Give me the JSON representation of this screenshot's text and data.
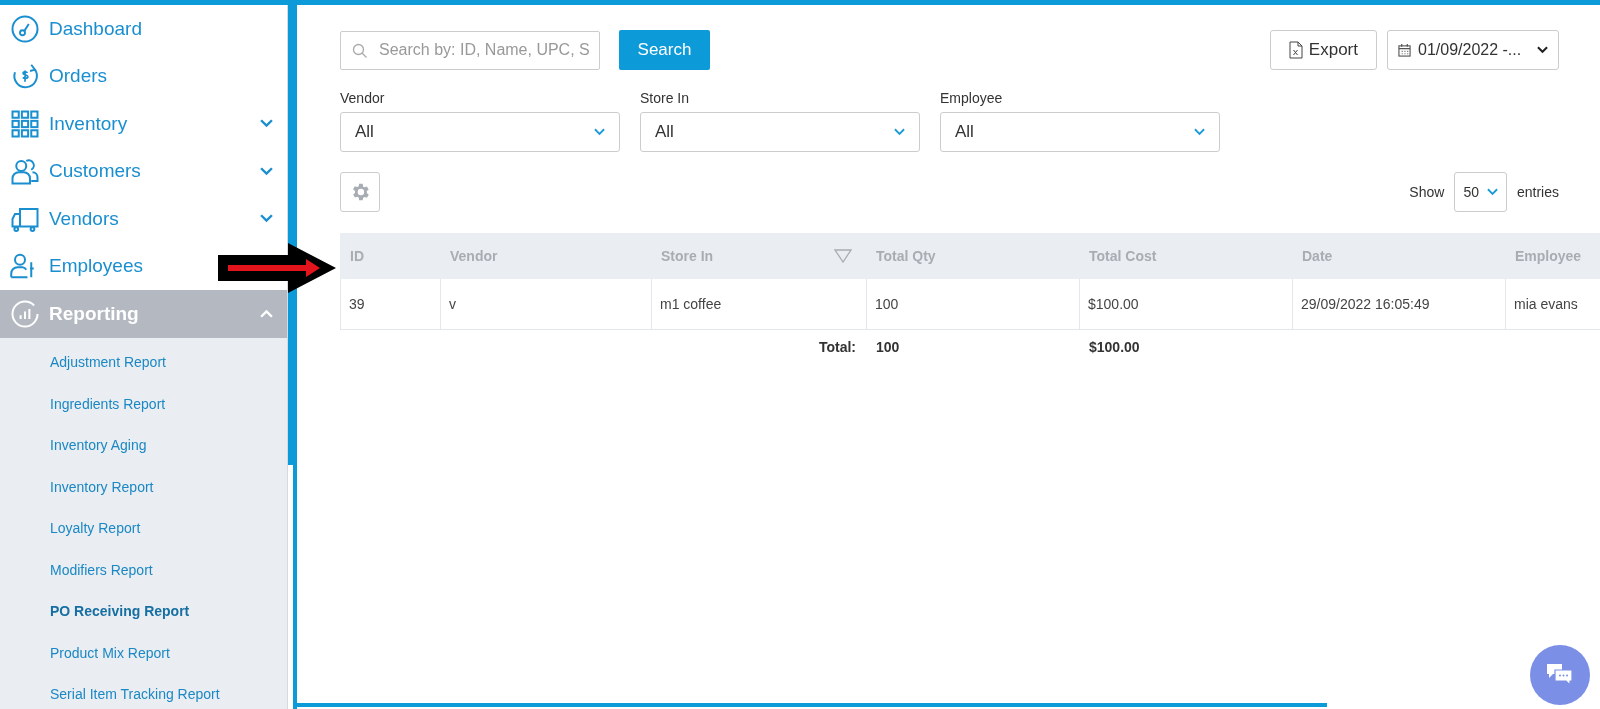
{
  "sidebar": {
    "items": [
      {
        "label": "Dashboard",
        "kind": "link",
        "selected": false
      },
      {
        "label": "Orders",
        "kind": "link",
        "selected": false
      },
      {
        "label": "Inventory",
        "kind": "group",
        "expanded": false,
        "selected": false
      },
      {
        "label": "Customers",
        "kind": "group",
        "expanded": false,
        "selected": false
      },
      {
        "label": "Vendors",
        "kind": "group",
        "expanded": false,
        "selected": false
      },
      {
        "label": "Employees",
        "kind": "link",
        "selected": false
      },
      {
        "label": "Reporting",
        "kind": "group",
        "expanded": true,
        "selected": true,
        "children": [
          {
            "label": "Adjustment Report",
            "selected": false
          },
          {
            "label": "Ingredients Report",
            "selected": false
          },
          {
            "label": "Inventory Aging",
            "selected": false
          },
          {
            "label": "Inventory Report",
            "selected": false
          },
          {
            "label": "Loyalty Report",
            "selected": false
          },
          {
            "label": "Modifiers Report",
            "selected": false
          },
          {
            "label": "PO Receiving Report",
            "selected": true
          },
          {
            "label": "Product Mix Report",
            "selected": false
          },
          {
            "label": "Serial Item Tracking Report",
            "selected": false
          }
        ]
      }
    ]
  },
  "toolbar": {
    "search": {
      "placeholder": "Search by: ID, Name, UPC, S"
    },
    "search_button": "Search",
    "export_button": "Export",
    "date_range": "01/09/2022 -..."
  },
  "filters": [
    {
      "label": "Vendor",
      "value": "All"
    },
    {
      "label": "Store In",
      "value": "All"
    },
    {
      "label": "Employee",
      "value": "All"
    }
  ],
  "page_size": {
    "prefix": "Show",
    "value": "50",
    "suffix": "entries"
  },
  "table": {
    "columns": [
      {
        "label": "ID"
      },
      {
        "label": "Vendor"
      },
      {
        "label": "Store In",
        "filter": true
      },
      {
        "label": "Total Qty"
      },
      {
        "label": "Total Cost"
      },
      {
        "label": "Date"
      },
      {
        "label": "Employee"
      }
    ],
    "rows": [
      [
        "39",
        "v",
        "m1 coffee",
        "100",
        "$100.00",
        "29/09/2022 16:05:49",
        "mia evans"
      ]
    ],
    "footer": {
      "label": "Total:",
      "values": [
        "100",
        "$100.00"
      ]
    }
  }
}
